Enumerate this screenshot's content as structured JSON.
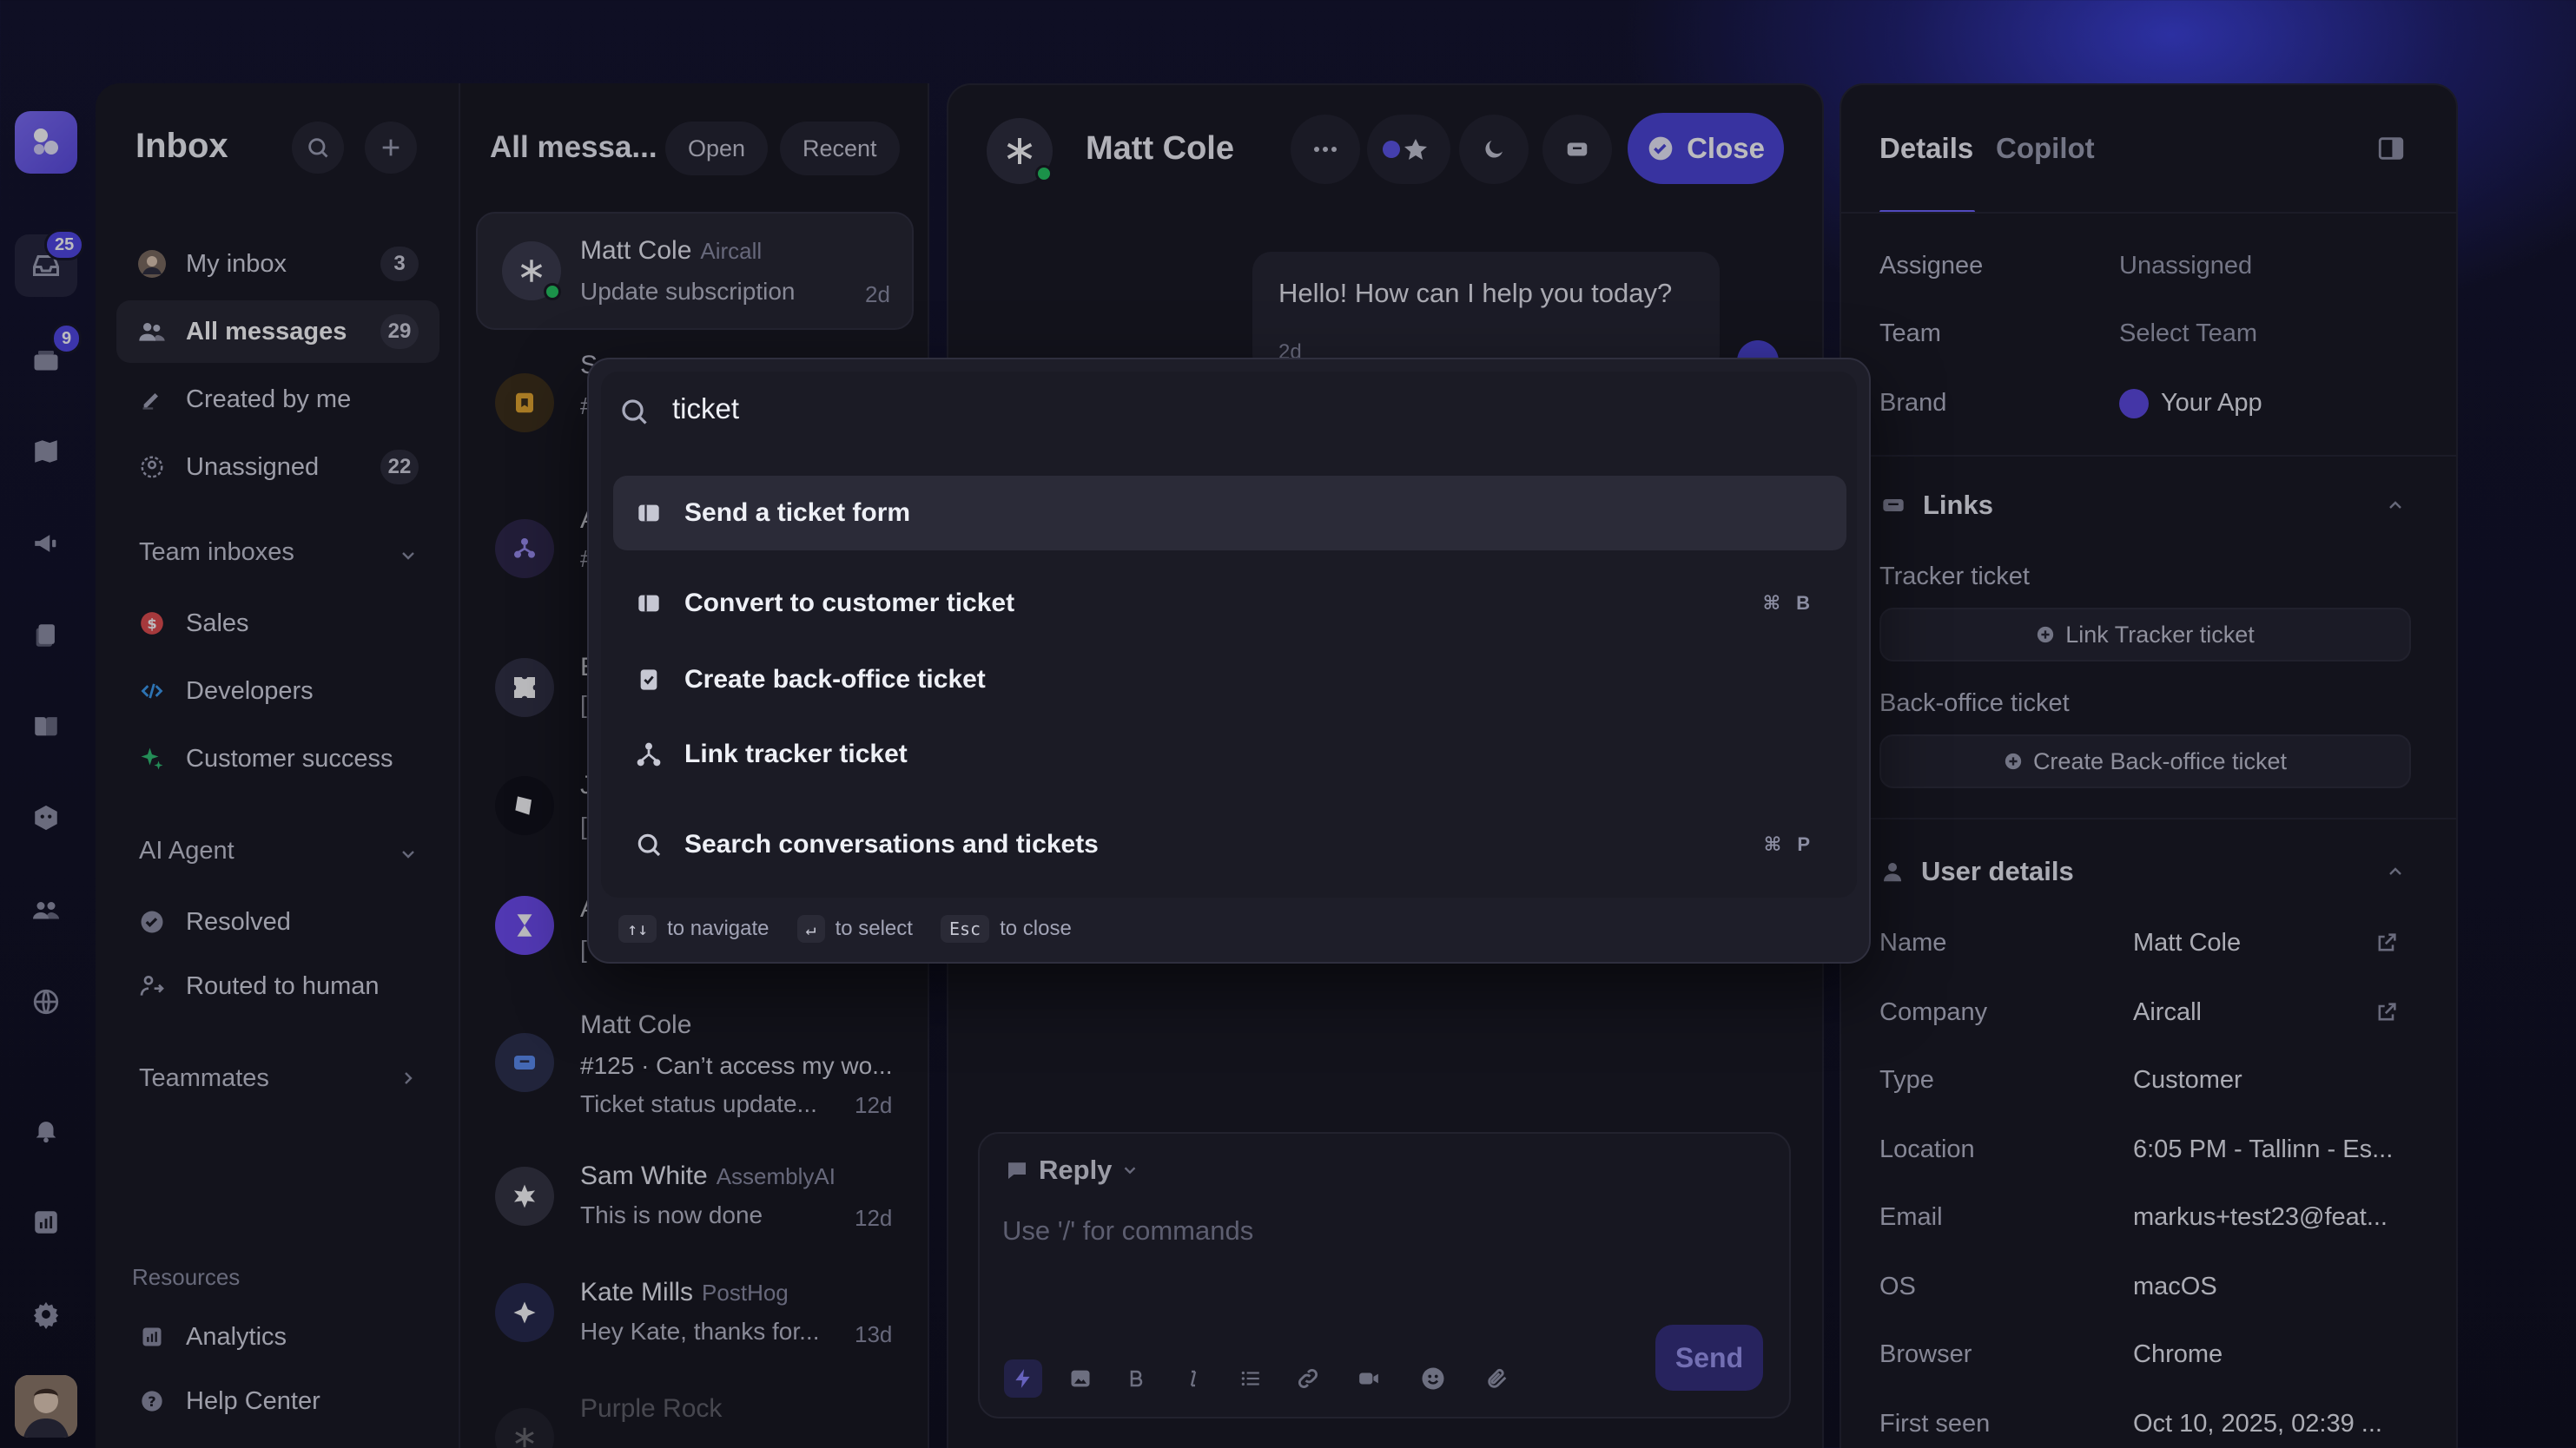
{
  "nav": {
    "title": "Inbox",
    "items": [
      {
        "label": "My inbox",
        "count": "3"
      },
      {
        "label": "All messages",
        "count": "29"
      },
      {
        "label": "Created by me",
        "count": ""
      },
      {
        "label": "Unassigned",
        "count": "22"
      }
    ],
    "team_inboxes_label": "Team inboxes",
    "teams": [
      {
        "label": "Sales"
      },
      {
        "label": "Developers"
      },
      {
        "label": "Customer success"
      }
    ],
    "ai_agent_label": "AI Agent",
    "ai_items": [
      {
        "label": "Resolved"
      },
      {
        "label": "Routed to human"
      }
    ],
    "teammates_label": "Teammates",
    "resources_label": "Resources",
    "resources": [
      {
        "label": "Analytics"
      },
      {
        "label": "Help Center"
      }
    ]
  },
  "rail": {
    "inbox_badge": "25",
    "tickets_badge": "9"
  },
  "list": {
    "title": "All messa...",
    "filter_open": "Open",
    "filter_recent": "Recent",
    "conversations": [
      {
        "name": "Matt Cole",
        "company": "Aircall",
        "preview": "Update subscription",
        "time": "2d"
      },
      {
        "name": "S",
        "company": "",
        "preview": "#",
        "time": ""
      },
      {
        "name": "A",
        "company": "",
        "preview": "#",
        "time": ""
      },
      {
        "name": "E",
        "company": "",
        "preview": "[",
        "time": ""
      },
      {
        "name": "J",
        "company": "",
        "preview": "[",
        "time": ""
      },
      {
        "name": "A",
        "company": "",
        "preview": "[",
        "time": ""
      },
      {
        "name": "Matt Cole",
        "company": "",
        "preview": "#125 · Can’t access my wo...",
        "preview2": "Ticket status update...",
        "time": "12d"
      },
      {
        "name": "Sam White",
        "company": "AssemblyAI",
        "preview": "This is now done",
        "time": "12d"
      },
      {
        "name": "Kate Mills",
        "company": "PostHog",
        "preview": "Hey Kate, thanks for...",
        "time": "13d"
      },
      {
        "name": "Purple Rock",
        "company": "",
        "preview": "",
        "time": ""
      }
    ]
  },
  "conversation": {
    "contact_name": "Matt Cole",
    "close_label": "Close",
    "message": "Hello! How can I help you today?",
    "message_time": "2d",
    "reply_label": "Reply",
    "reply_placeholder": "Use '/' for commands",
    "send_label": "Send"
  },
  "details": {
    "tab_details": "Details",
    "tab_copilot": "Copilot",
    "assignee_label": "Assignee",
    "assignee_value": "Unassigned",
    "team_label": "Team",
    "team_value": "Select Team",
    "brand_label": "Brand",
    "brand_value": "Your App",
    "links_label": "Links",
    "tracker_label": "Tracker ticket",
    "tracker_btn": "Link Tracker ticket",
    "backoffice_label": "Back-office ticket",
    "backoffice_btn": "Create Back-office ticket",
    "user_details_label": "User details",
    "fields": [
      {
        "label": "Name",
        "value": "Matt Cole"
      },
      {
        "label": "Company",
        "value": "Aircall"
      },
      {
        "label": "Type",
        "value": "Customer"
      },
      {
        "label": "Location",
        "value": "6:05 PM - Tallinn - Es..."
      },
      {
        "label": "Email",
        "value": "markus+test23@feat..."
      },
      {
        "label": "OS",
        "value": "macOS"
      },
      {
        "label": "Browser",
        "value": "Chrome"
      },
      {
        "label": "First seen",
        "value": "Oct 10, 2025, 02:39 ..."
      }
    ]
  },
  "palette": {
    "query": "ticket",
    "items": [
      {
        "label": "Send a ticket form",
        "shortcut": ""
      },
      {
        "label": "Convert to customer ticket",
        "shortcut": "⌘ B"
      },
      {
        "label": "Create back-office ticket",
        "shortcut": ""
      },
      {
        "label": "Link tracker ticket",
        "shortcut": ""
      },
      {
        "label": "Search conversations and tickets",
        "shortcut": "⌘ P"
      }
    ],
    "footer": {
      "nav_key": "↑↓",
      "nav_text": "to navigate",
      "select_key": "↵",
      "select_text": "to select",
      "close_key": "Esc",
      "close_text": "to close"
    }
  },
  "colors": {
    "accent": "#4a43d6",
    "online": "#22c55e",
    "background": "#0c0c1a"
  }
}
